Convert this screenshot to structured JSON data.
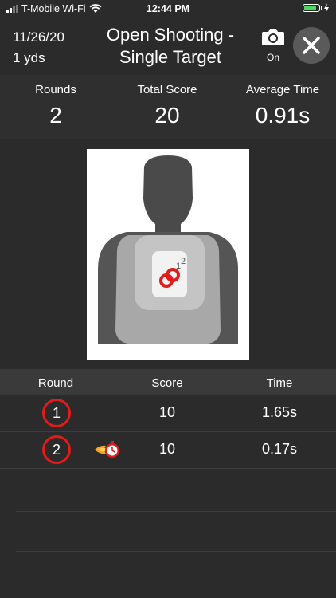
{
  "status_bar": {
    "carrier": "T-Mobile Wi-Fi",
    "time": "12:44 PM",
    "battery_level": 0.9,
    "battery_color": "#4cd964"
  },
  "header": {
    "date": "11/26/20",
    "distance": "1 yds",
    "title_line1": "Open Shooting -",
    "title_line2": "Single Target",
    "camera_state": "On",
    "camera_icon": "camera-icon",
    "close_icon": "close-icon"
  },
  "stats": {
    "rounds_label": "Rounds",
    "rounds_value": "2",
    "total_score_label": "Total Score",
    "total_score_value": "20",
    "avg_time_label": "Average Time",
    "avg_time_value": "0.91s"
  },
  "target": {
    "shot_labels": [
      "1",
      "2"
    ],
    "hit_color": "#e21b1b"
  },
  "table": {
    "headers": {
      "round": "Round",
      "score": "Score",
      "time": "Time"
    },
    "rows": [
      {
        "round": "1",
        "score": "10",
        "time": "1.65s",
        "badge": null
      },
      {
        "round": "2",
        "score": "10",
        "time": "0.17s",
        "badge": "fast-shot-icon"
      }
    ]
  }
}
